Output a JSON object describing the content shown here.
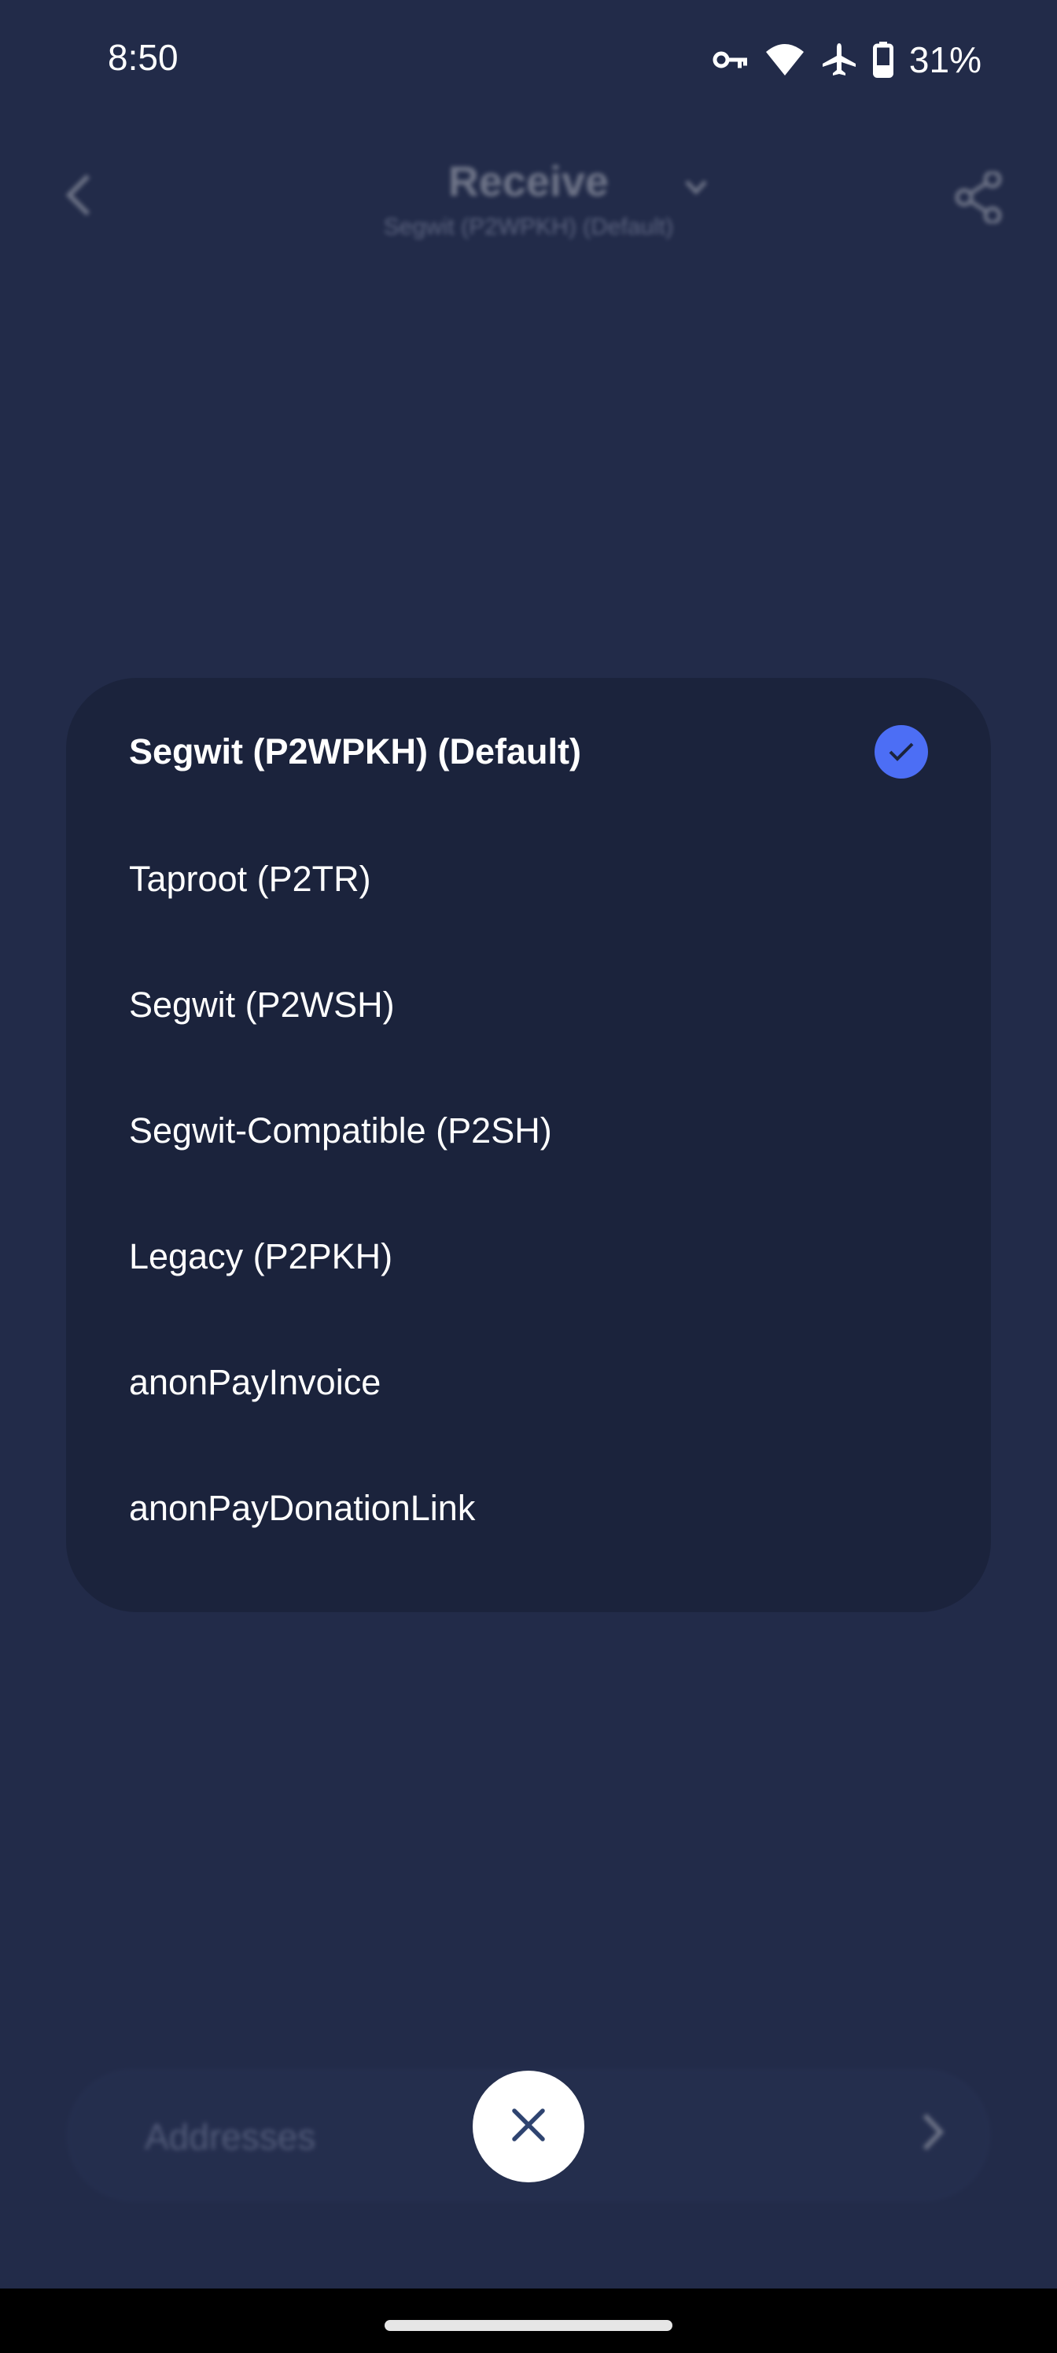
{
  "status_bar": {
    "time": "8:50",
    "icons": [
      "vpn-key-icon",
      "wifi-icon",
      "airplane-icon",
      "battery-icon"
    ],
    "battery_percent": "31%"
  },
  "background_page": {
    "title": "Receive",
    "subtitle": "Segwit (P2WPKH) (Default)",
    "address_label": "Addresses"
  },
  "picker": {
    "items": [
      {
        "label": "Segwit (P2WPKH) (Default)",
        "selected": true
      },
      {
        "label": "Taproot (P2TR)",
        "selected": false
      },
      {
        "label": "Segwit (P2WSH)",
        "selected": false
      },
      {
        "label": "Segwit-Compatible (P2SH)",
        "selected": false
      },
      {
        "label": "Legacy (P2PKH)",
        "selected": false
      },
      {
        "label": "anonPayInvoice",
        "selected": false
      },
      {
        "label": "anonPayDonationLink",
        "selected": false
      }
    ]
  },
  "colors": {
    "background": "#222b49",
    "sheet": "#1b233c",
    "accent": "#4c6ef5"
  }
}
